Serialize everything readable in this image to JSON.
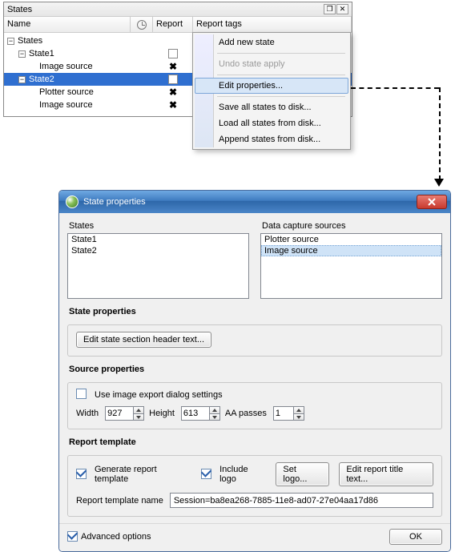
{
  "top_panel": {
    "title": "States",
    "columns": {
      "name": "Name",
      "report": "Report",
      "tags": "Report tags"
    },
    "rows": {
      "root": "States",
      "state1": "State1",
      "state1_img": "Image source",
      "state2": "State2",
      "state2_plot": "Plotter source",
      "state2_img": "Image source"
    }
  },
  "context_menu": {
    "add": "Add new state",
    "undo": "Undo state apply",
    "edit": "Edit properties...",
    "save": "Save all states to disk...",
    "load": "Load all states from disk...",
    "append": "Append states from disk..."
  },
  "dialog": {
    "title": "State properties",
    "labels": {
      "states": "States",
      "sources": "Data capture sources",
      "state_props": "State properties",
      "source_props": "Source properties",
      "report_tmpl": "Report template",
      "width": "Width",
      "height": "Height",
      "aa": "AA passes",
      "tmpl_name": "Report template name"
    },
    "lists": {
      "states": [
        "State1",
        "State2"
      ],
      "sources": [
        "Plotter source",
        "Image source"
      ]
    },
    "buttons": {
      "edit_header": "Edit state section header text...",
      "set_logo": "Set logo...",
      "edit_title": "Edit report title text...",
      "ok": "OK"
    },
    "checkboxes": {
      "use_export": "Use image export dialog settings",
      "gen_tmpl": "Generate report template",
      "incl_logo": "Include logo",
      "adv": "Advanced options"
    },
    "fields": {
      "width": "927",
      "height": "613",
      "aa": "1",
      "tmpl_name": "Session=ba8ea268-7885-11e8-ad07-27e04aa17d86"
    }
  }
}
